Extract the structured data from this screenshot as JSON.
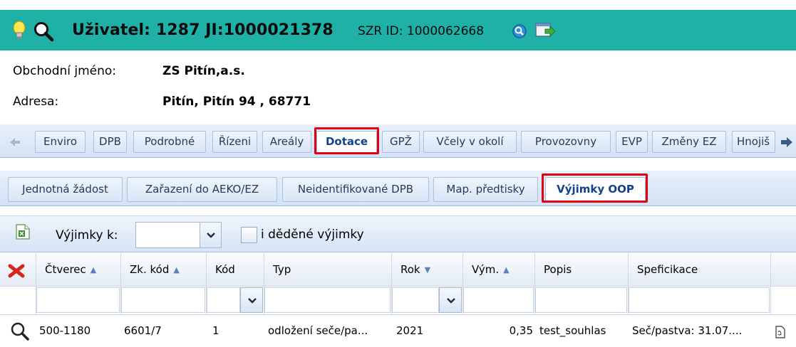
{
  "header": {
    "user_label": "Uživatel:",
    "user_id": "1287",
    "ji_label": "JI:",
    "ji_value": "1000021378",
    "szr_label": "SZR ID:",
    "szr_value": "1000062668",
    "bg_color": "#1fb0a6",
    "icons": [
      "lightbulb-icon",
      "search-icon",
      "refresh-icon",
      "export-icon"
    ]
  },
  "info": {
    "business_name_label": "Obchodní jméno:",
    "business_name_value": "ZS Pitín,a.s.",
    "address_label": "Adresa:",
    "address_value": "Pitín, Pitín 94 , 68771"
  },
  "tabs": {
    "items": [
      {
        "label": "Enviro"
      },
      {
        "label": "DPB"
      },
      {
        "label": "Podrobné"
      },
      {
        "label": "Řízeni"
      },
      {
        "label": "Areály"
      },
      {
        "label": "Dotace",
        "active": true
      },
      {
        "label": "GPŽ"
      },
      {
        "label": "Včely v okolí"
      },
      {
        "label": "Provozovny"
      },
      {
        "label": "EVP"
      },
      {
        "label": "Změny EZ"
      },
      {
        "label": "Hnojiš"
      }
    ],
    "active": "Dotace"
  },
  "subtabs": {
    "items": [
      {
        "label": "Jednotná žádost"
      },
      {
        "label": "Zařazení do AEKO/EZ"
      },
      {
        "label": "Neidentifikované DPB"
      },
      {
        "label": "Map. předtisky"
      },
      {
        "label": "Výjimky OOP",
        "active": true
      }
    ],
    "active": "Výjimky OOP"
  },
  "toolbar": {
    "exceptions_label": "Výjimky k:",
    "exceptions_value": "",
    "inherited_label": "i děděné výjimky",
    "inherited_checked": false
  },
  "grid": {
    "columns": [
      {
        "label": "Čtverec",
        "sort": "asc"
      },
      {
        "label": "Zk. kód",
        "sort": "asc"
      },
      {
        "label": "Kód",
        "sort": ""
      },
      {
        "label": "Typ",
        "sort": ""
      },
      {
        "label": "Rok",
        "sort": "desc"
      },
      {
        "label": "Vým.",
        "sort": "asc"
      },
      {
        "label": "Popis",
        "sort": ""
      },
      {
        "label": "Speficikace",
        "sort": ""
      }
    ],
    "rows": [
      {
        "ctverec": "500-1180",
        "zk_kod": "6601/7",
        "kod": "1",
        "typ": "odložení seče/pa...",
        "rok": "2021",
        "vym": "0,35",
        "popis": "test_souhlas",
        "specifikace": "Seč/pastva: 31.07...."
      }
    ]
  },
  "colors": {
    "highlight": "#e0000e",
    "header": "#1fb0a6",
    "tab_text": "#2a3a55",
    "active_tab_text": "#15428b"
  }
}
